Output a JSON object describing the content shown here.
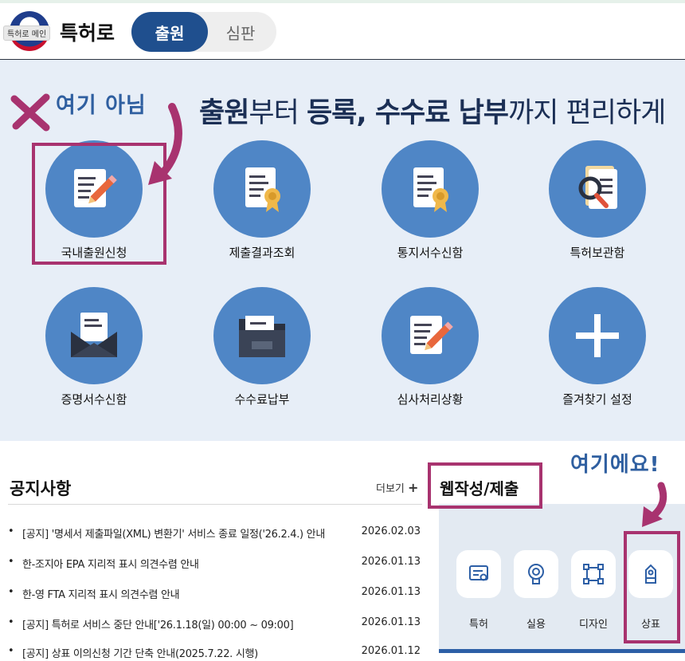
{
  "header": {
    "logo_badge": "특허로 메인",
    "logo_title": "특허로",
    "tab_active": "출원",
    "tab_inactive": "심판"
  },
  "hero": {
    "title_part1": "출원",
    "title_part2": "부터 ",
    "title_part3": "등록, 수수료 납부",
    "title_part4": "까지 편리하게",
    "services": [
      {
        "label": "국내출원신청",
        "icon": "pencil-document-icon"
      },
      {
        "label": "제출결과조회",
        "icon": "certificate-document-icon"
      },
      {
        "label": "통지서수신함",
        "icon": "certificate-document-icon"
      },
      {
        "label": "특허보관함",
        "icon": "magnifier-document-icon"
      },
      {
        "label": "증명서수신함",
        "icon": "envelope-document-icon"
      },
      {
        "label": "수수료납부",
        "icon": "folder-icon"
      },
      {
        "label": "심사처리상황",
        "icon": "pencil-document-icon"
      },
      {
        "label": "즐겨찾기 설정",
        "icon": "plus-icon"
      }
    ]
  },
  "annotations": {
    "not_here": "여기 아님",
    "here": "여기에요!",
    "color": "#a8336f"
  },
  "notice": {
    "title": "공지사항",
    "more_label": "더보기",
    "more_icon": "+",
    "items": [
      {
        "title": "[공지] '명세서 제출파일(XML) 변환기' 서비스 종료 일정('26.2.4.) 안내",
        "date": "2026.02.03"
      },
      {
        "title": "한-조지아 EPA 지리적 표시 의견수렴 안내",
        "date": "2026.01.13"
      },
      {
        "title": "한-영 FTA 지리적 표시 의견수렴 안내",
        "date": "2026.01.13"
      },
      {
        "title": "[공지] 특허로 서비스 중단 안내['26.1.18(일) 00:00 ~ 09:00]",
        "date": "2026.01.13"
      },
      {
        "title": "[공지] 상표 이의신청 기간 단축 안내(2025.7.22. 시행)",
        "date": "2026.01.12"
      }
    ]
  },
  "web": {
    "title": "웹작성/제출",
    "items": [
      {
        "label": "특허",
        "icon": "patent-certificate-icon"
      },
      {
        "label": "실용",
        "icon": "utility-badge-icon"
      },
      {
        "label": "디자인",
        "icon": "design-frame-icon"
      },
      {
        "label": "상표",
        "icon": "trademark-tag-icon"
      }
    ]
  },
  "colors": {
    "brand_blue": "#1f4f8e",
    "circle_blue": "#4f86c6",
    "hero_bg": "#e7eef7"
  }
}
